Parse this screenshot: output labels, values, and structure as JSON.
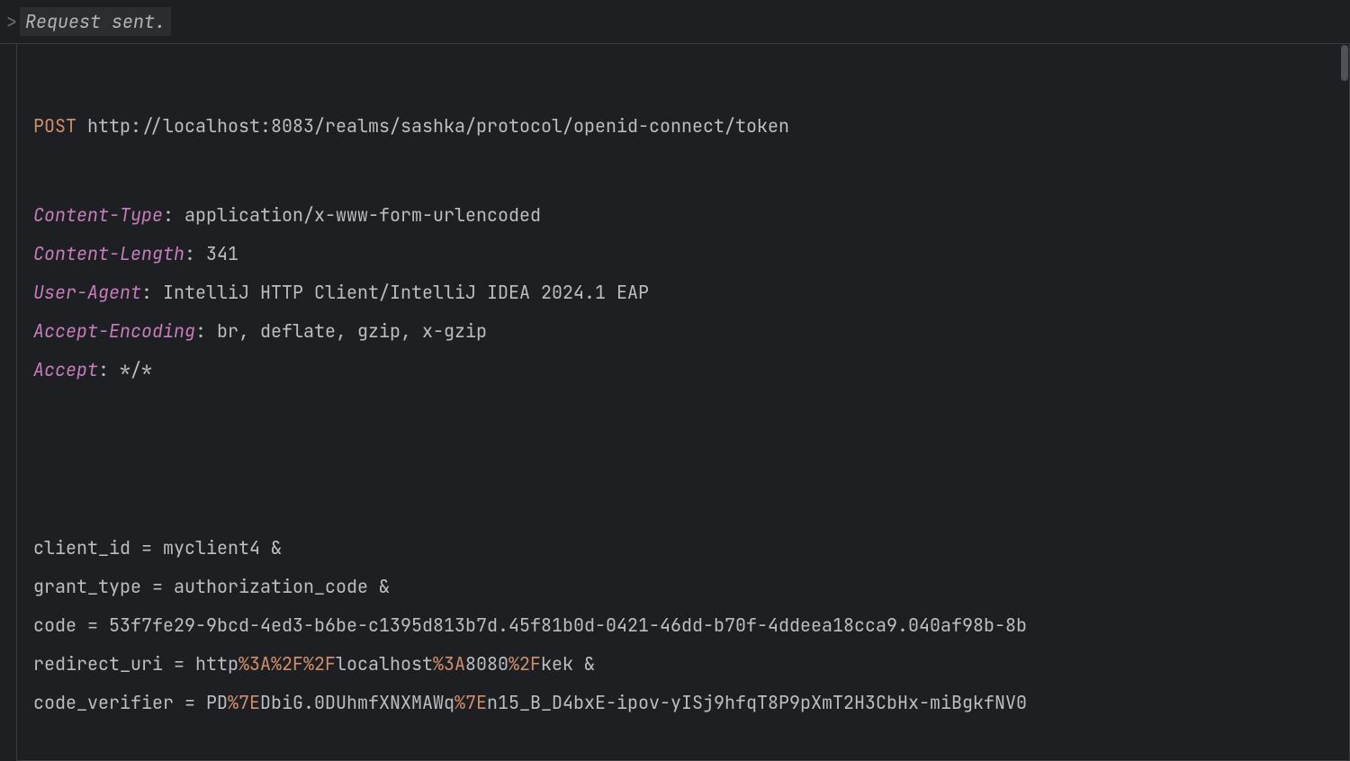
{
  "header": {
    "chevron": ">",
    "status": "Request sent."
  },
  "request": {
    "method": "POST",
    "url": "http://localhost:8083/realms/sashka/protocol/openid-connect/token",
    "headers": [
      {
        "name": "Content-Type",
        "value": "application/x-www-form-urlencoded"
      },
      {
        "name": "Content-Length",
        "value": "341"
      },
      {
        "name": "User-Agent",
        "value": "IntelliJ HTTP Client/IntelliJ IDEA 2024.1 EAP"
      },
      {
        "name": "Accept-Encoding",
        "value": "br, deflate, gzip, x-gzip"
      },
      {
        "name": "Accept",
        "value": "*/*"
      }
    ],
    "body_params": [
      {
        "key": "client_id",
        "value_segments": [
          {
            "t": "myclient4",
            "e": false
          }
        ],
        "amp": true
      },
      {
        "key": "grant_type",
        "value_segments": [
          {
            "t": "authorization_code",
            "e": false
          }
        ],
        "amp": true
      },
      {
        "key": "code",
        "value_segments": [
          {
            "t": "53f7fe29-9bcd-4ed3-b6be-c1395d813b7d.45f81b0d-0421-46dd-b70f-4ddeea18cca9.040af98b-8b",
            "e": false
          }
        ],
        "amp": false
      },
      {
        "key": "redirect_uri",
        "value_segments": [
          {
            "t": "http",
            "e": false
          },
          {
            "t": "%3A%2F%2F",
            "e": true
          },
          {
            "t": "localhost",
            "e": false
          },
          {
            "t": "%3A",
            "e": true
          },
          {
            "t": "8080",
            "e": false
          },
          {
            "t": "%2F",
            "e": true
          },
          {
            "t": "kek",
            "e": false
          }
        ],
        "amp": true
      },
      {
        "key": "code_verifier",
        "value_segments": [
          {
            "t": "PD",
            "e": false
          },
          {
            "t": "%7E",
            "e": true
          },
          {
            "t": "DbiG.0DUhmfXNXMAWq",
            "e": false
          },
          {
            "t": "%7E",
            "e": true
          },
          {
            "t": "n15_B_D4bxE-ipov-yISj9hfqT8P9pXmT2H3CbHx-miBgkfNV0",
            "e": false
          }
        ],
        "amp": false
      }
    ]
  }
}
